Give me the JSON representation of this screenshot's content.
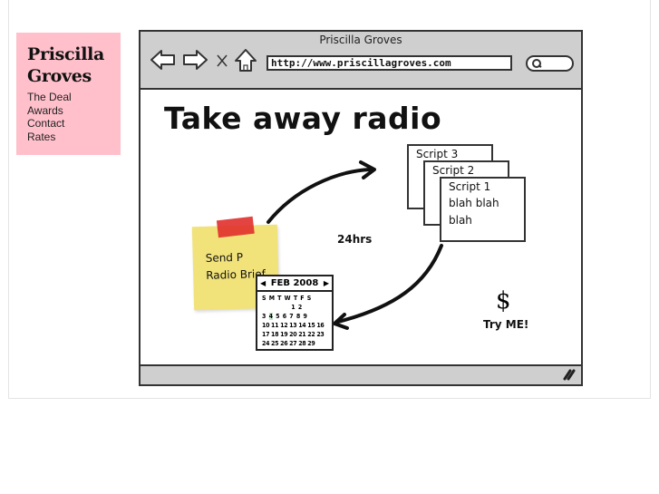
{
  "sidebar": {
    "brand_line1": "Priscilla",
    "brand_line2": "Groves",
    "nav": [
      "The Deal",
      "Awards",
      "Contact",
      "Rates"
    ],
    "background": "#ffc0cb"
  },
  "browser": {
    "window_title": "Priscilla Groves",
    "url": "http://www.priscillagroves.com",
    "icons": [
      "back-arrow-icon",
      "forward-arrow-icon",
      "stop-icon",
      "home-icon",
      "search-icon",
      "resize-grip-icon"
    ]
  },
  "mockup": {
    "headline": "Take away radio",
    "sticky_note": {
      "line1": "Send P",
      "line2": "Radio Brief"
    },
    "calendar": {
      "month": "FEB 2008",
      "weekdays": "S M T W T F S",
      "rows": [
        "            1 2",
        "3 4 5 6 7 8 9",
        "10 11 12 13 14 15 16",
        "17 18 19 20 21 22 23",
        "24 25 26 27 28 29"
      ],
      "highlighted_day": "4"
    },
    "duration_label": "24hrs",
    "scripts": [
      {
        "title": "Script 3"
      },
      {
        "title": "Script 2"
      },
      {
        "title": "Script 1",
        "body1": "blah blah",
        "body2": "blah"
      }
    ],
    "price_symbol": "$",
    "cta": "Try ME!"
  }
}
